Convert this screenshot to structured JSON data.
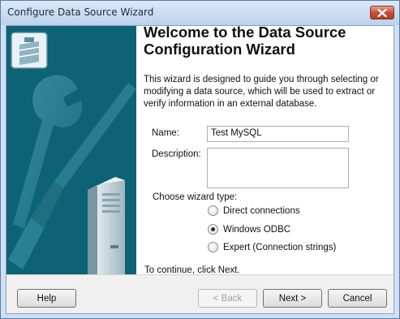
{
  "window": {
    "title": "Configure Data Source Wizard"
  },
  "content": {
    "heading": "Welcome to the Data Source Configuration Wizard",
    "intro": "This wizard is designed to guide you through selecting or modifying a data source, which will be used to extract or verify information in an external database.",
    "name_label": "Name:",
    "name_value": "Test MySQL",
    "description_label": "Description:",
    "description_value": "",
    "wizard_type_label": "Choose wizard type:",
    "wizard_types": [
      {
        "label": "Direct connections",
        "checked": false
      },
      {
        "label": "Windows ODBC",
        "checked": true
      },
      {
        "label": "Expert (Connection strings)",
        "checked": false
      }
    ],
    "footer_hint": "To continue, click Next."
  },
  "buttons": {
    "help": "Help",
    "back": "< Back",
    "next": "Next >",
    "cancel": "Cancel"
  },
  "icons": {
    "close": "close-icon",
    "wizard_graphic": "tools-server-illustration",
    "database": "database-icon"
  }
}
